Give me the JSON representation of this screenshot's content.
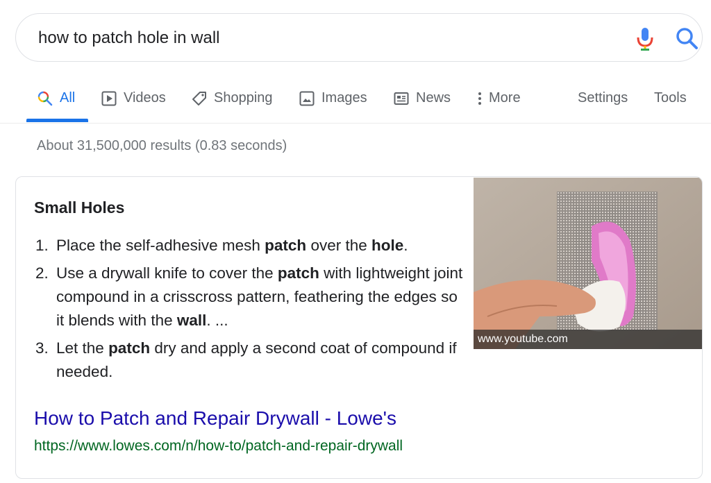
{
  "search": {
    "query": "how to patch hole in wall"
  },
  "tabs": [
    {
      "label": "All",
      "icon": "search-icon",
      "active": true
    },
    {
      "label": "Videos",
      "icon": "play-icon"
    },
    {
      "label": "Shopping",
      "icon": "tag-icon"
    },
    {
      "label": "Images",
      "icon": "image-icon"
    },
    {
      "label": "News",
      "icon": "newspaper-icon"
    },
    {
      "label": "More",
      "icon": "more-vert-icon"
    }
  ],
  "tools": {
    "settings": "Settings",
    "tools": "Tools"
  },
  "result_stats": "About 31,500,000 results (0.83 seconds)",
  "snippet": {
    "title": "Small Holes",
    "steps": [
      {
        "num": "1.",
        "parts": [
          {
            "t": "Place the self-adhesive mesh "
          },
          {
            "t": "patch",
            "b": true
          },
          {
            "t": " over the "
          },
          {
            "t": "hole",
            "b": true
          },
          {
            "t": "."
          }
        ]
      },
      {
        "num": "2.",
        "parts": [
          {
            "t": "Use a drywall knife to cover the "
          },
          {
            "t": "patch",
            "b": true
          },
          {
            "t": " with lightweight joint compound in a crisscross pattern, feathering the edges so it blends with the "
          },
          {
            "t": "wall",
            "b": true
          },
          {
            "t": ". ..."
          }
        ]
      },
      {
        "num": "3.",
        "parts": [
          {
            "t": "Let the "
          },
          {
            "t": "patch",
            "b": true
          },
          {
            "t": " dry and apply a second coat of compound if needed."
          }
        ]
      }
    ],
    "image_caption": "www.youtube.com",
    "link_title": "How to Patch and Repair Drywall - Lowe's",
    "link_url": "https://www.lowes.com/n/how-to/patch-and-repair-drywall"
  },
  "colors": {
    "active_tab": "#1a73e8",
    "link": "#1a0dab",
    "url": "#006621"
  }
}
